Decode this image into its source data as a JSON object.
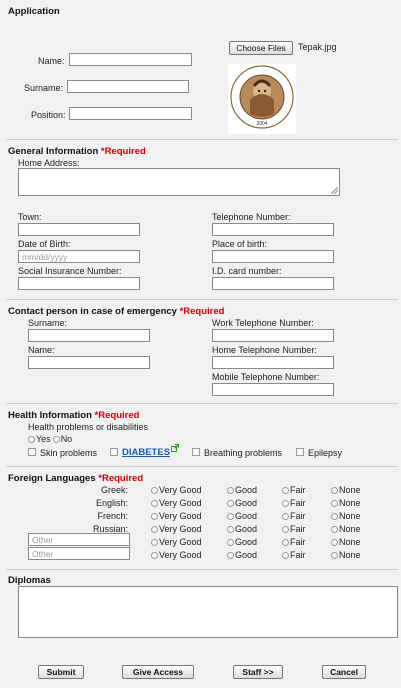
{
  "form_title": "Application",
  "personal": {
    "name_label": "Name:",
    "surname_label": "Surname:",
    "position_label": "Position:",
    "choose_files_label": "Choose Files",
    "file_name": "Tepak.jpg",
    "photo_text_top": "ΤΕΧΝΟΛΟΓΙΚΟ ΠΑΝΕΠΙΣΤΗΜΙΟ ΚΥΠΡΟΥ",
    "photo_year": "2004"
  },
  "general": {
    "title": "General Information",
    "required": "*Required",
    "home_address_label": "Home Address:",
    "town_label": "Town:",
    "telephone_label": "Telephone Number:",
    "dob_label": "Date of Birth:",
    "dob_placeholder": "mm/dd/yyyy",
    "place_of_birth_label": "Place of birth:",
    "social_insurance_label": "Social Insurance Number:",
    "id_card_label": "I.D. card number:"
  },
  "emergency": {
    "title": "Contact person in case of emergency",
    "required": "*Required",
    "surname_label": "Surname:",
    "name_label": "Name:",
    "work_tel_label": "Work Telephone Number:",
    "home_tel_label": "Home Telephone Number:",
    "mobile_tel_label": "Mobile Telephone Number:"
  },
  "health": {
    "title": "Health Information",
    "required": "*Required",
    "question": "Health problems or disabilities",
    "yes": "Yes",
    "no": "No",
    "skin": "Skin problems",
    "diabetes": "DIABETES",
    "breathing": "Breathing problems",
    "epilepsy": "Epilepsy"
  },
  "languages": {
    "title": "Foreign Languages",
    "required": "*Required",
    "rows": [
      "Greek:",
      "English:",
      "French:",
      "Russian:"
    ],
    "other_placeholder": "Other",
    "levels": [
      "Very Good",
      "Good",
      "Fair",
      "None"
    ]
  },
  "diplomas": {
    "title": "Diplomas"
  },
  "buttons": {
    "submit": "Submit",
    "give_access": "Give Access",
    "staff": "Staff >>",
    "cancel": "Cancel"
  },
  "colors": {
    "required": "#d00000",
    "link": "#1a5aa8",
    "background": "#f1f1f1"
  }
}
